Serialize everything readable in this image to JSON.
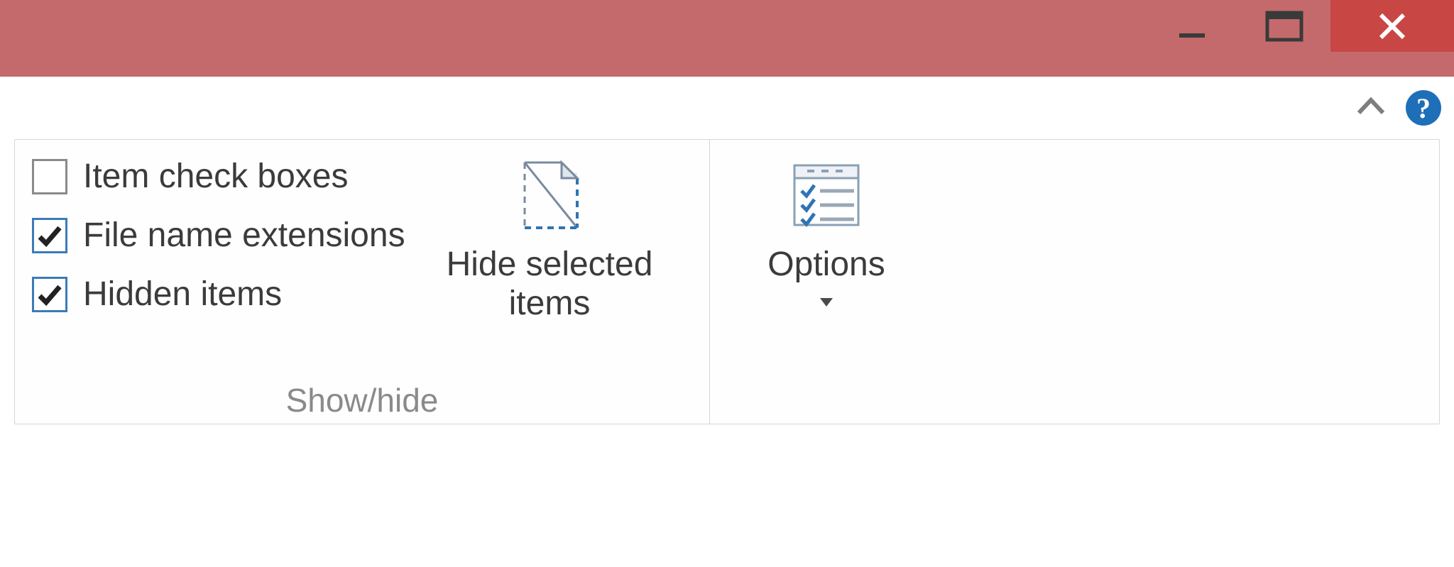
{
  "ribbon": {
    "group_showhide_label": "Show/hide",
    "checkboxes": [
      {
        "label": "Item check boxes",
        "checked": false
      },
      {
        "label": "File name extensions",
        "checked": true
      },
      {
        "label": "Hidden items",
        "checked": true
      }
    ],
    "hide_selected_label_line1": "Hide selected",
    "hide_selected_label_line2": "items",
    "options_label": "Options"
  },
  "help_glyph": "?"
}
